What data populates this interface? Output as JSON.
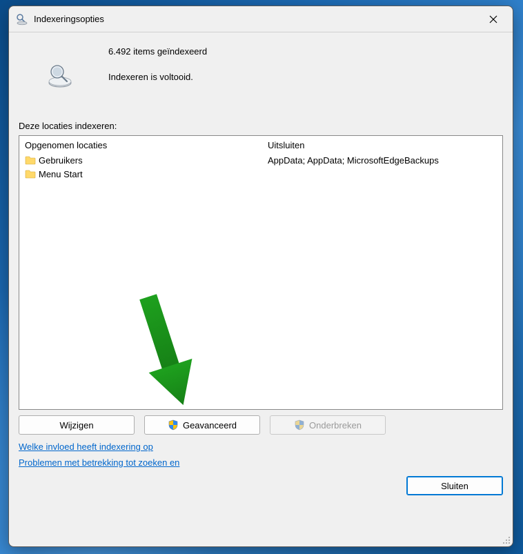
{
  "window": {
    "title": "Indexeringsopties"
  },
  "status": {
    "count_line": "6.492 items geïndexeerd",
    "state_line": "Indexeren is voltooid."
  },
  "locations": {
    "section_label": "Deze locaties indexeren:",
    "included_header": "Opgenomen locaties",
    "excluded_header": "Uitsluiten",
    "items": [
      {
        "label": "Gebruikers",
        "exclude": "AppData; AppData; MicrosoftEdgeBackups"
      },
      {
        "label": "Menu Start",
        "exclude": ""
      }
    ]
  },
  "buttons": {
    "modify": "Wijzigen",
    "advanced": "Geavanceerd",
    "pause": "Onderbreken",
    "close": "Sluiten"
  },
  "links": {
    "influence": "Welke invloed heeft indexering op",
    "troubleshoot": "Problemen met betrekking tot zoeken en"
  }
}
